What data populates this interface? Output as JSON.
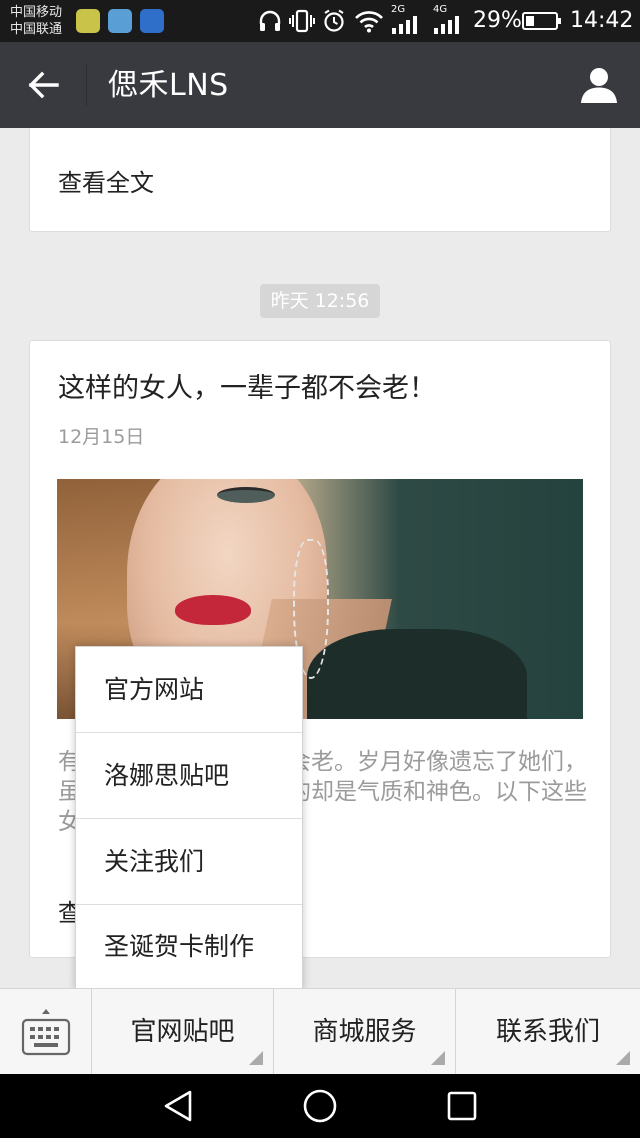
{
  "status_bar": {
    "carrier_1": "中国移动",
    "carrier_2": "中国联通",
    "net_1": "2G",
    "net_2": "4G",
    "battery": "29%",
    "time": "14:42",
    "icons": [
      "headphones-icon",
      "vibrate-icon",
      "alarm-icon",
      "wifi-icon",
      "signal-icon",
      "signal-icon",
      "battery-icon"
    ]
  },
  "header": {
    "title": "偲禾LNS",
    "back_icon": "arrow-left-icon",
    "profile_icon": "person-icon"
  },
  "feed": {
    "previous_card": {
      "read_more": "查看全文"
    },
    "timestamp": "昨天 12:56",
    "article": {
      "headline": "这样的女人，一辈子都不会老！",
      "date": "12月15日",
      "summary": "有些女人，一辈子都不会老。岁月好像遗忘了她们，虽然容颜会老去，不老的却是气质和神色。以下这些女人的特质，缺一不可！",
      "read_more": "查看全文"
    }
  },
  "popup_menu": {
    "items": [
      "官方网站",
      "洛娜思贴吧",
      "关注我们",
      "圣诞贺卡制作"
    ]
  },
  "menu_bar": {
    "keyboard_icon": "keyboard-icon",
    "buttons": [
      "官网贴吧",
      "商城服务",
      "联系我们"
    ]
  },
  "nav_bar": {
    "icons": [
      "back-triangle-icon",
      "home-circle-icon",
      "recent-square-icon"
    ]
  }
}
